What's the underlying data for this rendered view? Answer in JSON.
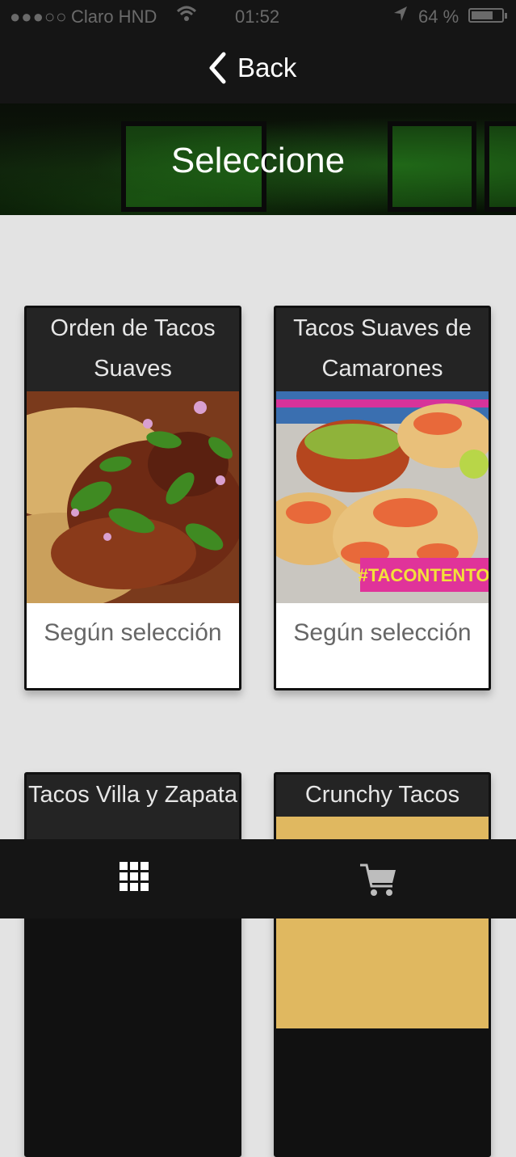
{
  "status_bar": {
    "signal": "●●●○○",
    "carrier": "Claro HND",
    "time": "01:52",
    "battery": "64 %"
  },
  "nav": {
    "back_label": "Back"
  },
  "banner": {
    "title": "Seleccione"
  },
  "products": [
    {
      "title": "Orden de Tacos Suaves",
      "price": "Según selección"
    },
    {
      "title": "Tacos Suaves de Camarones",
      "price": "Según selección",
      "badge": "#TACONTENTO"
    },
    {
      "title": "Tacos Villa y Zapata"
    },
    {
      "title": "Crunchy Tacos"
    }
  ],
  "tabbar": {
    "items": [
      "grid-menu",
      "cart"
    ]
  },
  "colors": {
    "bar": "#151515",
    "card_title": "#242424",
    "background": "#e3e3e3"
  }
}
